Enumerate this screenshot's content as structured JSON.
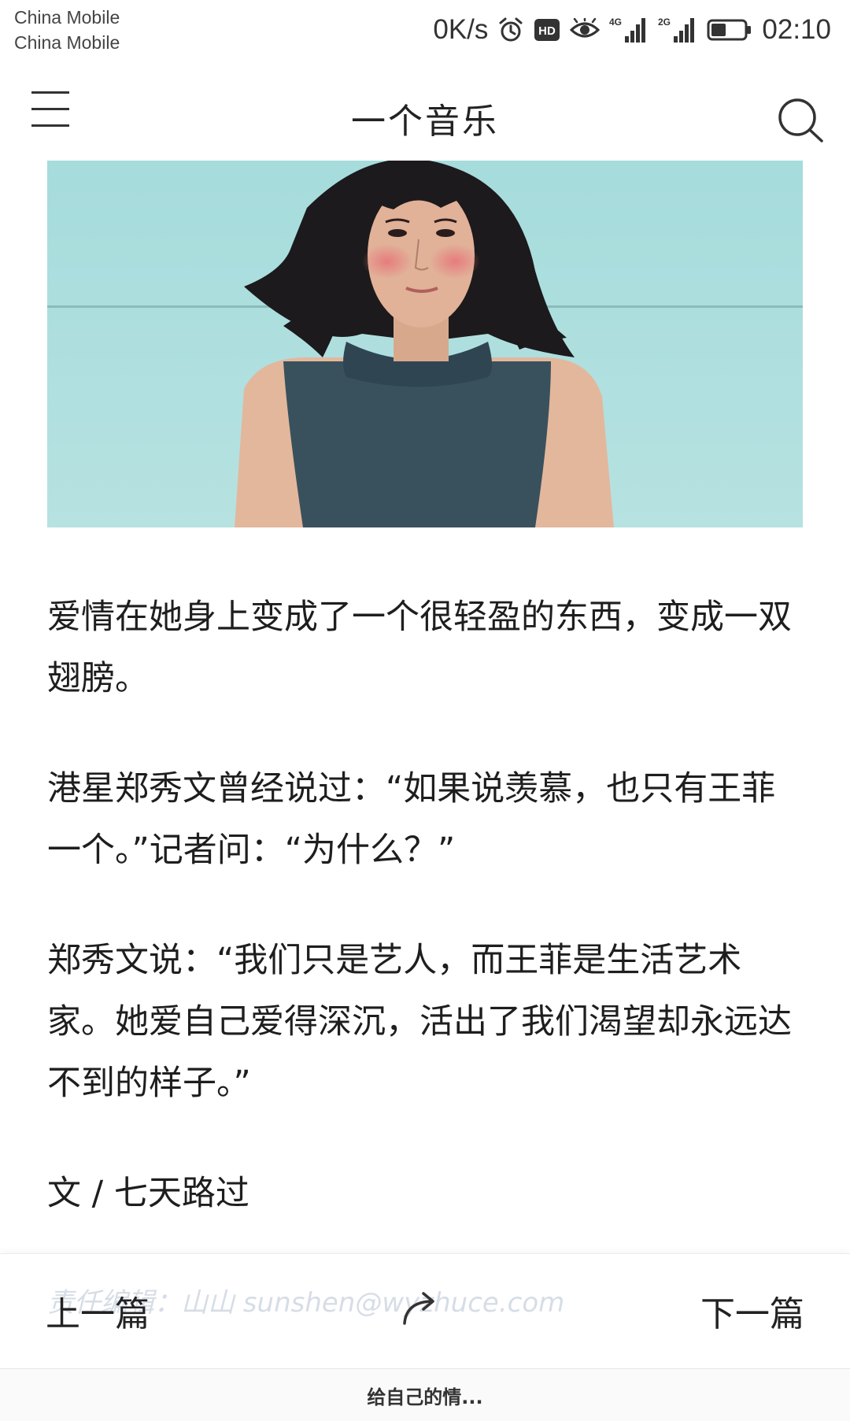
{
  "status_bar": {
    "carrier_1": "China Mobile",
    "carrier_2": "China Mobile",
    "net_speed": "0K/s",
    "icons": [
      "alarm-icon",
      "hd-icon",
      "eye-care-icon",
      "signal-4g-icon",
      "signal-2g-icon",
      "battery-icon"
    ],
    "signal_1_label": "4G",
    "signal_2_label": "2G",
    "hd_label": "HD",
    "battery_level": 0.45,
    "time": "02:10"
  },
  "header": {
    "title": "一个音乐",
    "menu_icon": "menu-icon",
    "search_icon": "search-icon"
  },
  "article": {
    "paragraphs": [
      "爱情在她身上变成了一个很轻盈的东西，变成一双翅膀。",
      "港星郑秀文曾经说过：“如果说羡慕，也只有王菲一个。”记者问：“为什么？”",
      "郑秀文说：“我们只是艺人，而王菲是生活艺术家。她爱自己爱得深沉，活出了我们渴望却永远达不到的样子。”",
      "文 / 七天路过"
    ]
  },
  "bottom_nav": {
    "watermark": "责任编辑：山山 sunshen@wyzhuce.com",
    "prev_label": "上一篇",
    "next_label": "下一篇",
    "share_icon": "share-icon"
  },
  "mini_player": {
    "title": "给自己的情..."
  },
  "colors": {
    "background": "#ffffff",
    "text": "#1e1e1e",
    "photo_background": "#a9dcdb",
    "watermark": "#d6dde6"
  }
}
